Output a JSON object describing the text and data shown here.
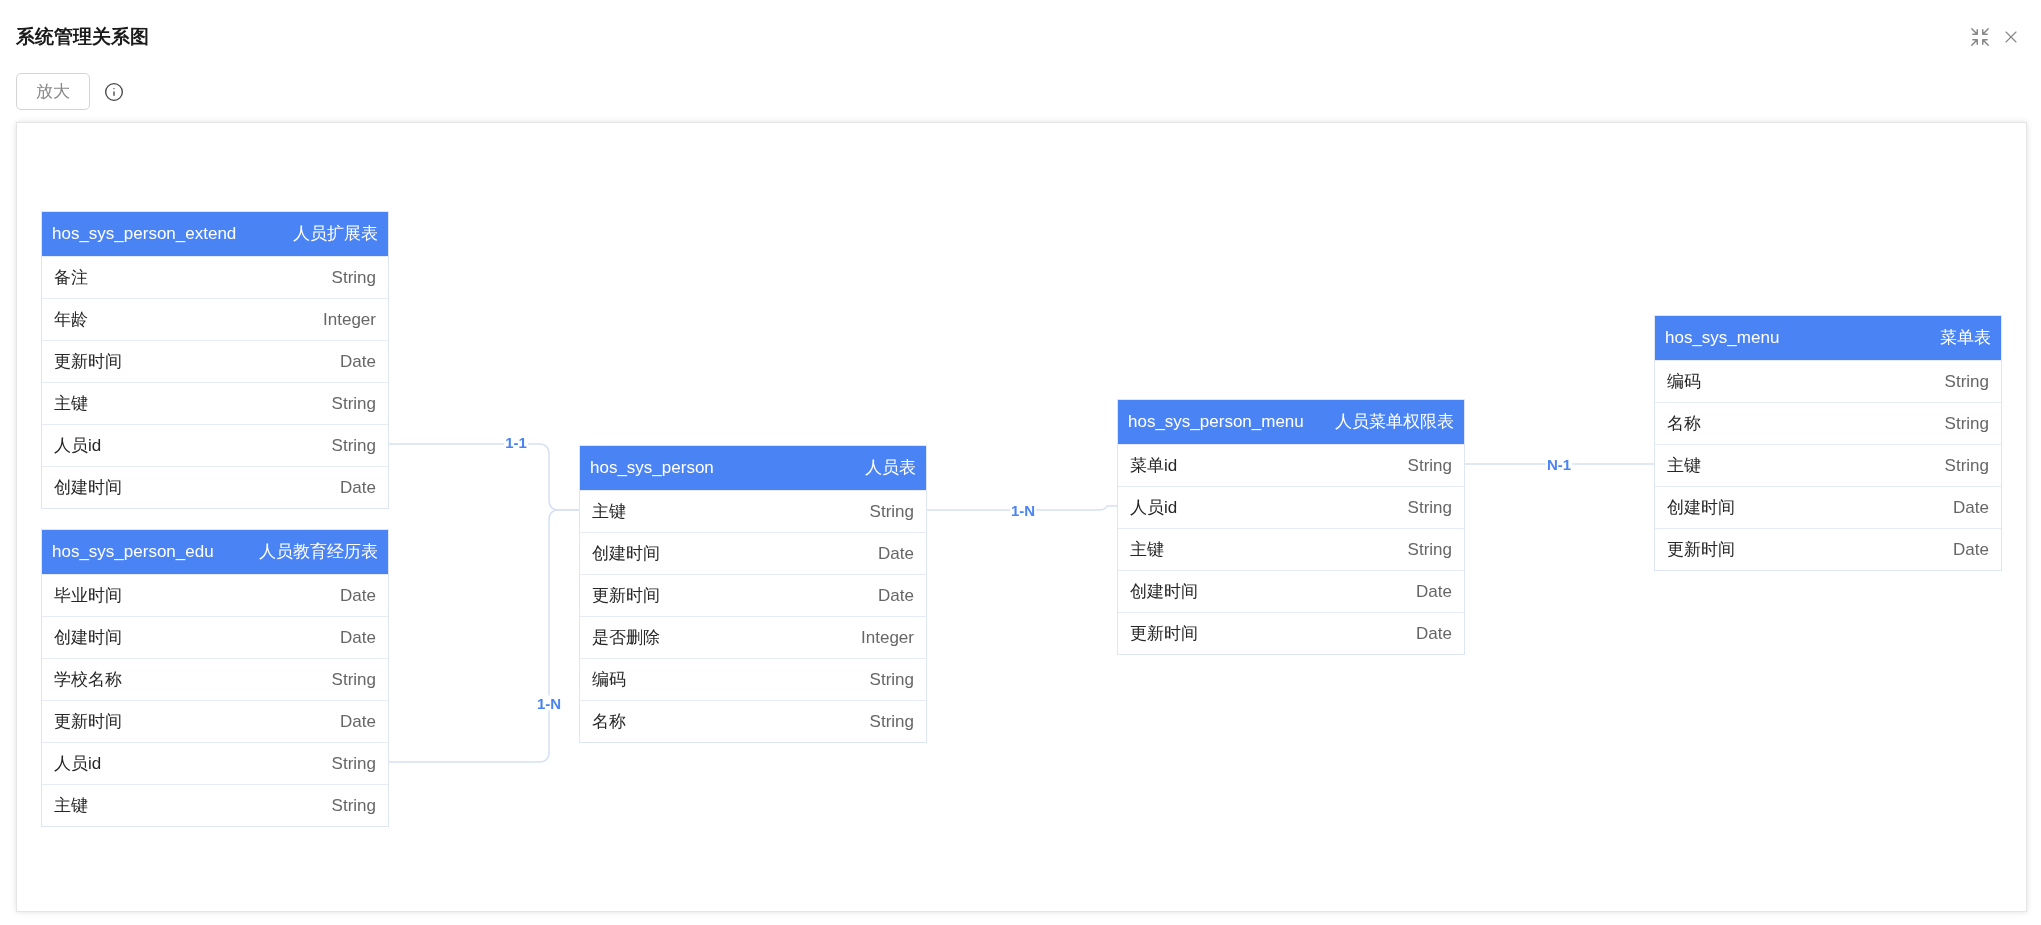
{
  "dialog": {
    "title": "系统管理关系图"
  },
  "toolbar": {
    "zoom_button": "放大"
  },
  "tables": [
    {
      "name": "hos_sys_person_extend",
      "label": "人员扩展表",
      "fields": [
        {
          "name": "备注",
          "type": "String"
        },
        {
          "name": "年龄",
          "type": "Integer"
        },
        {
          "name": "更新时间",
          "type": "Date"
        },
        {
          "name": "主键",
          "type": "String"
        },
        {
          "name": "人员id",
          "type": "String"
        },
        {
          "name": "创建时间",
          "type": "Date"
        }
      ]
    },
    {
      "name": "hos_sys_person_edu",
      "label": "人员教育经历表",
      "fields": [
        {
          "name": "毕业时间",
          "type": "Date"
        },
        {
          "name": "创建时间",
          "type": "Date"
        },
        {
          "name": "学校名称",
          "type": "String"
        },
        {
          "name": "更新时间",
          "type": "Date"
        },
        {
          "name": "人员id",
          "type": "String"
        },
        {
          "name": "主键",
          "type": "String"
        }
      ]
    },
    {
      "name": "hos_sys_person",
      "label": "人员表",
      "fields": [
        {
          "name": "主键",
          "type": "String"
        },
        {
          "name": "创建时间",
          "type": "Date"
        },
        {
          "name": "更新时间",
          "type": "Date"
        },
        {
          "name": "是否删除",
          "type": "Integer"
        },
        {
          "name": "编码",
          "type": "String"
        },
        {
          "name": "名称",
          "type": "String"
        }
      ]
    },
    {
      "name": "hos_sys_person_menu",
      "label": "人员菜单权限表",
      "fields": [
        {
          "name": "菜单id",
          "type": "String"
        },
        {
          "name": "人员id",
          "type": "String"
        },
        {
          "name": "主键",
          "type": "String"
        },
        {
          "name": "创建时间",
          "type": "Date"
        },
        {
          "name": "更新时间",
          "type": "Date"
        }
      ]
    },
    {
      "name": "hos_sys_menu",
      "label": "菜单表",
      "fields": [
        {
          "name": "编码",
          "type": "String"
        },
        {
          "name": "名称",
          "type": "String"
        },
        {
          "name": "主键",
          "type": "String"
        },
        {
          "name": "创建时间",
          "type": "Date"
        },
        {
          "name": "更新时间",
          "type": "Date"
        }
      ]
    }
  ],
  "relations": [
    {
      "label": "1-1"
    },
    {
      "label": "1-N"
    },
    {
      "label": "1-N"
    },
    {
      "label": "N-1"
    }
  ]
}
